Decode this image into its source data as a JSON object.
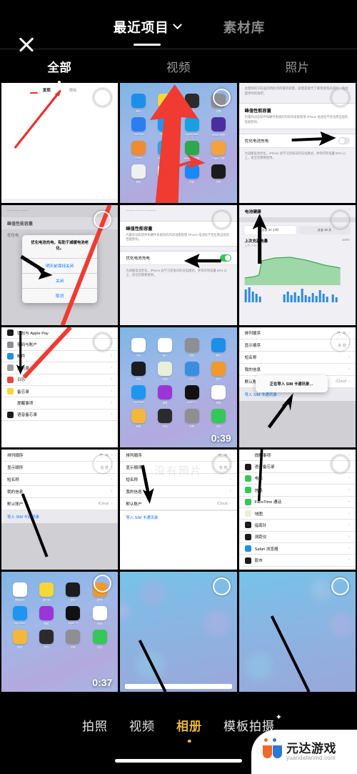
{
  "header": {
    "close_icon": "close-icon",
    "tabs": [
      {
        "label": "最近项目",
        "active": true,
        "has_chevron": true
      },
      {
        "label": "素材库",
        "active": false,
        "has_chevron": false
      }
    ]
  },
  "filters": [
    {
      "label": "全部",
      "active": true
    },
    {
      "label": "视频",
      "active": false
    },
    {
      "label": "照片",
      "active": false
    }
  ],
  "overlay": {
    "empty_text": "没有照片"
  },
  "bottom_nav": {
    "modes": [
      {
        "label": "拍照",
        "active": false
      },
      {
        "label": "视频",
        "active": false
      },
      {
        "label": "相册",
        "active": true
      },
      {
        "label": "模板拍摄",
        "active": false,
        "sparkle": "✦"
      }
    ]
  },
  "watermark": {
    "title": "元达游戏",
    "subtitle": "yuandafanmd.com",
    "accent_orange": "#f0682a",
    "accent_blue": "#2b79d4"
  },
  "colors": {
    "background": "#000000",
    "active_gold": "#e8b93c",
    "ios_blue": "#007aff",
    "toggle_green": "#34c759",
    "red_arrow": "#e8322c"
  },
  "gallery": {
    "items": [
      {
        "id": "cell-1",
        "kind": "screenshot-white-tabs",
        "selected": false,
        "duration": "",
        "content": {
          "tabs": [
            "发现",
            "模板"
          ],
          "annotation": "red-arrow"
        }
      },
      {
        "id": "cell-2",
        "kind": "screenshot-homescreen",
        "selected": false,
        "duration": "",
        "content": {
          "apps": [
            {
              "label": "邮件",
              "color": "#1e8fe8"
            },
            {
              "label": "备忘录",
              "color": "#f5d73a"
            },
            {
              "label": "钱包",
              "color": "#2b2b2b"
            },
            {
              "label": "设置",
              "color": "#8e8e93"
            },
            {
              "label": "FaceTime",
              "color": "#2c7ef0"
            },
            {
              "label": "App Store",
              "color": "#1e96f0"
            },
            {
              "label": "Apple Store",
              "color": "#1aa0e0"
            },
            {
              "label": "iMovie 剪辑",
              "color": "#4b2e9e"
            },
            {
              "label": "iTunes",
              "color": "#ef8b32"
            },
            {
              "label": "Keynote 讲演",
              "color": "#2ea3e0"
            },
            {
              "label": "Numbers 表格",
              "color": "#2ea84a"
            },
            {
              "label": "Pages 文稿",
              "color": "#f2a33c"
            },
            {
              "label": "微信",
              "color": "#f0f0f0"
            },
            {
              "label": "QQ",
              "color": "#ffffff"
            },
            {
              "label": "快影",
              "color": "#1989fa"
            },
            {
              "label": "视频",
              "color": "#1a1a1a"
            }
          ],
          "annotation": "red-arrow-large"
        }
      },
      {
        "id": "cell-3",
        "kind": "screenshot-battery-settings",
        "selected": false,
        "duration": "",
        "content": {
          "intro": "此量和的于较差的用此的的毒的容量。容量是取代了最等放电光的比。电池量用时的规范。",
          "section_title": "峰值性能容量",
          "section_body": "内置的动态软件和硬件系统的的的改进能管理 iPhone 电池化学老化而出现的性能影响。",
          "toggle_row": "优化电池充电",
          "toggle_on": false,
          "footer": "为减缓电池老化，iPhone 会学习您每日的充电模式，并等待到电量 80% 以上，直至您需要使用。",
          "annotation": "black-arrow-right"
        }
      },
      {
        "id": "cell-4",
        "kind": "screenshot-battery-dialog",
        "selected": false,
        "duration": "",
        "content": {
          "section_title": "峰值性能容量",
          "toggle_row": "优化电",
          "dialog_message": "优化电池充电，有助于减缓电池老化。",
          "dialog_options": [
            "明天前保持关闭",
            "关闭",
            "取消"
          ],
          "annotation": "black-arrow-to-close"
        }
      },
      {
        "id": "cell-5",
        "kind": "screenshot-battery-settings",
        "selected": false,
        "duration": "",
        "content": {
          "section_title": "峰值性能容量",
          "section_body": "内置的动态软件和硬件系统的的的改进能管理 iPhone 电池化学老化而出现的性能影响。",
          "toggle_row": "优化电池充电",
          "toggle_on": true,
          "footer": "为减缓电池老化，iPhone 会学习您每日的充电模式，并等待到电量 80% 以上，直至您需要使用。",
          "annotation": "black-arrow-left"
        }
      },
      {
        "id": "cell-6",
        "kind": "screenshot-battery-chart",
        "selected": false,
        "duration": "",
        "content": {
          "title": "电池健康",
          "segments": [
            "过去 24 小时",
            "过去 10 天"
          ],
          "selected_segment": "过去 24 小时",
          "chart_title": "上次充满电量",
          "chart_sub": "上午 7:45",
          "percent": "100%",
          "annotation": "black-arrow-up"
        }
      },
      {
        "id": "cell-7",
        "kind": "screenshot-settings-list",
        "selected": false,
        "duration": "",
        "content": {
          "rows": [
            {
              "label": "钱包与 Apple Pay",
              "color": "#1c1c1e"
            },
            {
              "label": "密码与账户",
              "color": "#8e8e93"
            },
            {
              "label": "邮件",
              "color": "#1e8fe8"
            },
            {
              "label": "通讯录",
              "color": "#9a9aa0"
            },
            {
              "label": "日历",
              "color": "#e8453c"
            },
            {
              "label": "备忘录",
              "color": "#f5d73a"
            },
            {
              "label": "提醒事项",
              "color": "#ffffff"
            },
            {
              "label": "语音备忘录",
              "color": "#1c1c1e"
            }
          ],
          "annotation": "red-and-black-arrow"
        }
      },
      {
        "id": "cell-8",
        "kind": "screenshot-homescreen-video",
        "selected": false,
        "duration": "0:39",
        "content": {
          "apps": [
            {
              "label": "日历",
              "color": "#ffffff"
            },
            {
              "label": "照片",
              "color": "#ffffff"
            },
            {
              "label": "相机",
              "color": "#8e8e93"
            },
            {
              "label": "邮件",
              "color": "#1e8fe8"
            },
            {
              "label": "时钟",
              "color": "#1c1c1e"
            },
            {
              "label": "地图",
              "color": "#e8f0d8"
            },
            {
              "label": "天气",
              "color": "#3a8ee0"
            },
            {
              "label": "图书",
              "color": "#f09a2c"
            },
            {
              "label": "App Store",
              "color": "#1e96f0"
            },
            {
              "label": "播客",
              "color": "#9b35d8"
            },
            {
              "label": "Apple TV",
              "color": "#111111"
            },
            {
              "label": "健康",
              "color": "#ffffff"
            },
            {
              "label": "家庭",
              "color": "#f5b73a"
            },
            {
              "label": "钱包",
              "color": "#2b2b2b"
            },
            {
              "label": "设置",
              "color": "#8e8e93"
            },
            {
              "label": "信息",
              "color": "#34c759"
            }
          ]
        }
      },
      {
        "id": "cell-9",
        "kind": "screenshot-contacts-toast",
        "selected": false,
        "duration": "",
        "content": {
          "rows": [
            {
              "label": "排列顺序",
              "value": "姓, 名"
            },
            {
              "label": "显示顺序",
              "value": "名 姓"
            },
            {
              "label": "短名称",
              "value": ""
            },
            {
              "label": "我的信息",
              "value": ""
            },
            {
              "label": "默认账户",
              "value": "iCloud"
            }
          ],
          "action": "导入 SIM 卡通讯录",
          "toast": "正在导入 SIM 卡通讯录…",
          "annotation": "black-arrow-up-right"
        }
      },
      {
        "id": "cell-10",
        "kind": "screenshot-contacts-gray",
        "selected": false,
        "duration": "",
        "content": {
          "rows": [
            {
              "label": "排列顺序",
              "value": "姓, 名"
            },
            {
              "label": "显示顺序",
              "value": "名 姓"
            },
            {
              "label": "短名称",
              "value": ""
            },
            {
              "label": "我的信息",
              "value": ""
            },
            {
              "label": "默认账户",
              "value": "iCloud"
            }
          ],
          "action": "导入 SIM 卡通讯录",
          "annotation": "black-line"
        }
      },
      {
        "id": "cell-11",
        "kind": "screenshot-contacts-white",
        "selected": false,
        "duration": "",
        "content": {
          "rows": [
            {
              "label": "排列顺序",
              "value": "姓, 名"
            },
            {
              "label": "显示顺序",
              "value": "名 姓"
            },
            {
              "label": "短名称",
              "value": ""
            },
            {
              "label": "我的信息",
              "value": ""
            },
            {
              "label": "默认账户",
              "value": "iCloud"
            }
          ],
          "action": "导入 SIM 卡通讯录",
          "annotation": "black-arrow-down"
        }
      },
      {
        "id": "cell-12",
        "kind": "screenshot-settings-apps",
        "selected": false,
        "duration": "",
        "content": {
          "rows": [
            {
              "label": "提醒事项",
              "color": "#ffffff"
            },
            {
              "label": "语音备忘录",
              "color": "#1c1c1e"
            },
            {
              "label": "电话",
              "color": "#34c759"
            },
            {
              "label": "信息",
              "color": "#34c759"
            },
            {
              "label": "FaceTime 通话",
              "color": "#34c759"
            },
            {
              "label": "地图",
              "color": "#e8f0d8"
            },
            {
              "label": "指南针",
              "color": "#1c1c1e"
            },
            {
              "label": "测距仪",
              "color": "#1c1c1e"
            },
            {
              "label": "Safari 浏览器",
              "color": "#1e8fe8"
            },
            {
              "label": "股市",
              "color": "#1c1c1e"
            }
          ],
          "annotation": "black-line"
        }
      },
      {
        "id": "cell-13",
        "kind": "screenshot-homescreen-video",
        "selected": false,
        "duration": "0:37",
        "content": {
          "apps": [
            {
              "label": "提醒事项",
              "color": "#ffffff"
            },
            {
              "label": "备忘录",
              "color": "#f5d73a"
            },
            {
              "label": "股市",
              "color": "#1c1c1e"
            },
            {
              "label": "图书",
              "color": "#f09a2c"
            },
            {
              "label": "App Store",
              "color": "#1e96f0"
            },
            {
              "label": "播客",
              "color": "#9b35d8"
            },
            {
              "label": "Apple TV",
              "color": "#111111"
            },
            {
              "label": "健康",
              "color": "#ffffff"
            },
            {
              "label": "家庭",
              "color": "#f5b73a"
            },
            {
              "label": "钱包",
              "color": "#2b2b2b"
            },
            {
              "label": "设置",
              "color": "#8e8e93"
            },
            {
              "label": "信息",
              "color": "#34c759"
            }
          ]
        }
      },
      {
        "id": "cell-14",
        "kind": "wallpaper-blue",
        "selected": false,
        "duration": "",
        "content": {
          "annotation": "black-line"
        }
      },
      {
        "id": "cell-15",
        "kind": "wallpaper-blue",
        "selected": false,
        "duration": "",
        "content": {
          "annotation": "black-line"
        }
      }
    ]
  }
}
